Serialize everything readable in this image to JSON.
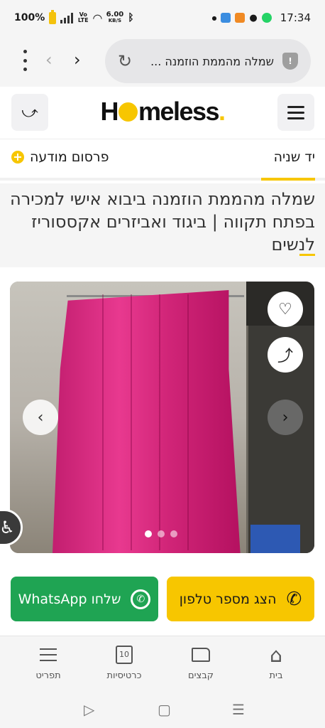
{
  "status_bar": {
    "battery": "100%",
    "net_speed": "6.00",
    "net_unit": "KB/S",
    "volte": "Vo LTE",
    "time": "17:34"
  },
  "browser": {
    "url_text": "שמלה מהממת הוזמנה ...",
    "back_icon": "‹",
    "forward_icon": "›",
    "reload_icon": "↻"
  },
  "header": {
    "logo_prefix": "H",
    "logo_suffix": "meless",
    "logo_dot": ".",
    "share_icon": "⤻"
  },
  "tabs": {
    "category": "יד שניה",
    "publish": "פרסום מודעה",
    "publish_icon": "+"
  },
  "listing": {
    "title": "שמלה מהממת הוזמנה ביבוא אישי למכירה בפתח תקווה | ביגוד ואביזרים אקססוריז לנשים"
  },
  "gallery": {
    "fav_icon": "♡",
    "share_icon": "⤴",
    "prev_icon": "‹",
    "next_icon": "›",
    "image_count": 3,
    "active_index": 0
  },
  "actions": {
    "whatsapp_label": "שלחו WhatsApp",
    "phone_label": "הצג מספר טלפון",
    "phone_icon": "✆",
    "whatsapp_icon": "✆"
  },
  "accessibility": {
    "icon": "♿"
  },
  "bottom_nav": {
    "home": "בית",
    "folders": "קבצים",
    "cards": "כרטיסיות",
    "cards_count": "10",
    "menu": "תפריט",
    "home_icon": "⌂"
  },
  "system_nav": {
    "back_icon": "▷",
    "home_icon": "▢",
    "recents_icon": "☰"
  },
  "colors": {
    "brand_yellow": "#f7c600",
    "whatsapp_green": "#1fa453"
  }
}
